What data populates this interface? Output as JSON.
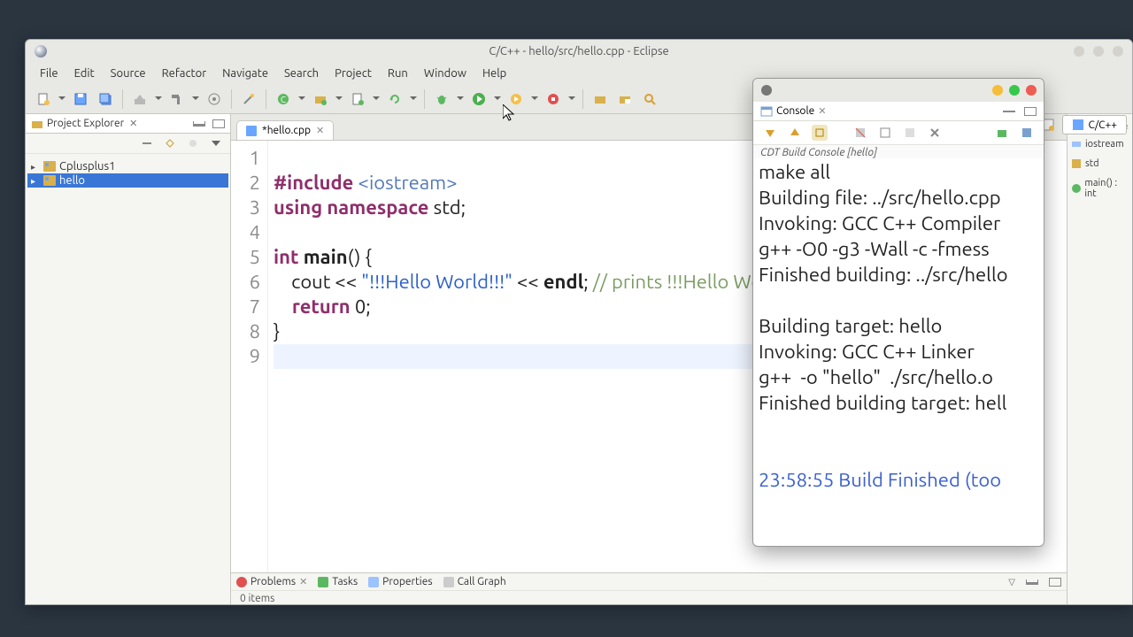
{
  "window": {
    "title": "C/C++ - hello/src/hello.cpp - Eclipse"
  },
  "menu": {
    "file": "File",
    "edit": "Edit",
    "source": "Source",
    "refactor": "Refactor",
    "navigate": "Navigate",
    "search": "Search",
    "project": "Project",
    "run": "Run",
    "window": "Window",
    "help": "Help"
  },
  "perspective": {
    "label": "C/C++"
  },
  "project_explorer": {
    "title": "Project Explorer",
    "items": [
      {
        "label": "Cplusplus1",
        "selected": false
      },
      {
        "label": "hello",
        "selected": true
      }
    ]
  },
  "editor": {
    "tab_label": "*hello.cpp",
    "lines": [
      "1",
      "2",
      "3",
      "4",
      "5",
      "6",
      "7",
      "8",
      "9"
    ],
    "code": {
      "l2_pre": "#include ",
      "l2_hdr": "<iostream>",
      "l3_a": "using ",
      "l3_b": "namespace ",
      "l3_c": "std;",
      "l5_a": "int ",
      "l5_b": "main",
      "l5_c": "() {",
      "l6_a": "    cout << ",
      "l6_b": "\"!!!Hello World!!!\" ",
      "l6_c": "<< ",
      "l6_d": "endl",
      "l6_e": "; ",
      "l6_f": "// prints !!!Hello World!!!",
      "l7_a": "    return ",
      "l7_b": "0;",
      "l8": "}"
    }
  },
  "bottom": {
    "problems": "Problems",
    "tasks": "Tasks",
    "properties": "Properties",
    "callgraph": "Call Graph",
    "items": "0 items"
  },
  "outline": {
    "symbols": [
      "iostream",
      "std",
      "main() : int"
    ]
  },
  "console": {
    "title": "Console",
    "sub": "CDT Build Console [hello]",
    "lines": [
      "make all",
      "Building file: ../src/hello.cpp",
      "Invoking: GCC C++ Compiler",
      "g++ -O0 -g3 -Wall -c -fmess",
      "Finished building: ../src/hello",
      "",
      "Building target: hello",
      "Invoking: GCC C++ Linker",
      "g++  -o \"hello\"  ./src/hello.o",
      "Finished building target: hell",
      "",
      ""
    ],
    "timestamp": "23:58:55 Build Finished (too"
  }
}
